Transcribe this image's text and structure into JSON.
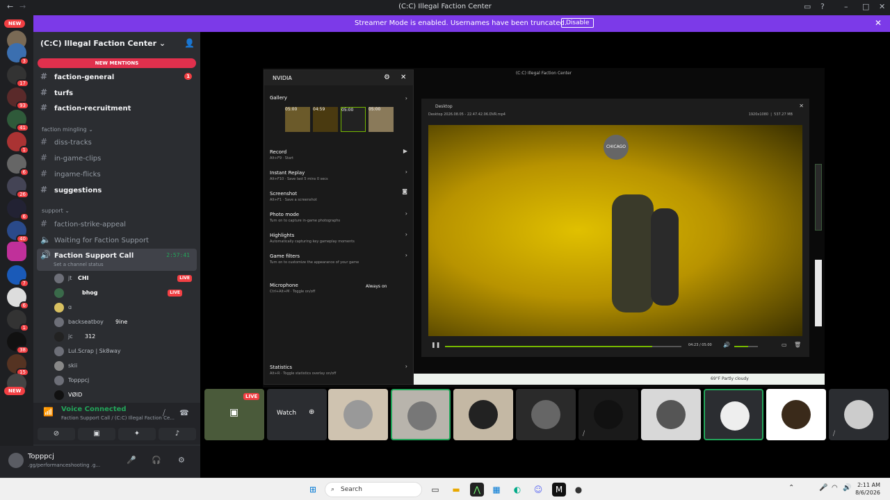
{
  "window": {
    "title": "(C:C) Illegal Faction Center"
  },
  "banner": {
    "text": "Streamer Mode is enabled. Usernames have been truncated.",
    "button": "Disable"
  },
  "server_list": {
    "new_top": "NEW",
    "new_bottom": "NEW",
    "badges": [
      "3",
      "17",
      "93",
      "41",
      "1",
      "6",
      "26",
      "6",
      "40",
      "7",
      "6",
      "1",
      "38",
      "15"
    ]
  },
  "guild": {
    "name": "(C:C) Illegal Faction Center"
  },
  "new_mentions": "NEW MENTIONS",
  "channels": [
    {
      "name": "faction-general",
      "badge": "1"
    },
    {
      "name": "turfs"
    },
    {
      "name": "faction-recruitment"
    }
  ],
  "category_mingling": "faction mingling",
  "mingling_channels": [
    {
      "name": "diss-tracks"
    },
    {
      "name": "in-game-clips"
    },
    {
      "name": "ingame-flicks"
    },
    {
      "name": "suggestions"
    }
  ],
  "category_support": "support",
  "support_channels": [
    {
      "name": "faction-strike-appeal"
    },
    {
      "name": "Waiting for Faction Support"
    }
  ],
  "active_voice": {
    "name": "Faction Support Call",
    "timer": "2:57:41",
    "status": "Set a channel status"
  },
  "members": [
    {
      "name": "jt",
      "tag": "CHI",
      "live": "LIVE"
    },
    {
      "name": "",
      "tag": "bhog",
      "live": "LIVE"
    },
    {
      "name": "ɑ"
    },
    {
      "name": "backseatboy",
      "tag": "9ine"
    },
    {
      "name": "jc",
      "tag": "312"
    },
    {
      "name": "Lul.Scrap | Sk8way"
    },
    {
      "name": "skii"
    },
    {
      "name": "Topppcj"
    },
    {
      "name": "VØID"
    }
  ],
  "voice_panel": {
    "connected": "Voice Connected",
    "sub": "Faction Support Call / (C:C) Illegal Faction Ce..."
  },
  "user": {
    "name": "Topppcj",
    "sub": ".gg/performanceshooting .g..."
  },
  "shared_window": {
    "title": "(C:C) Illegal Faction Center"
  },
  "nvidia": {
    "title": "NVIDIA",
    "gallery": "Gallery",
    "thumbs": [
      "05:00",
      "04:59",
      "05:00",
      "05:00"
    ],
    "items": [
      {
        "label": "Record",
        "sub": "Alt+F9 · Start"
      },
      {
        "label": "Instant Replay",
        "sub": "Alt+F10 · Save last 5 mins 0 secs"
      },
      {
        "label": "Screenshot",
        "sub": "Alt+F1 · Save a screenshot"
      },
      {
        "label": "Photo mode",
        "sub": "Turn on to capture in-game photographs"
      },
      {
        "label": "Highlights",
        "sub": "Automatically capturing key gameplay moments"
      },
      {
        "label": "Game filters",
        "sub": "Turn on to customize the appearance of your game"
      },
      {
        "label": "Microphone",
        "sub": "Ctrl+Alt+M · Toggle on/off",
        "value": "Always on"
      },
      {
        "label": "Statistics",
        "sub": "Alt+R · Toggle statistics overlay on/off"
      }
    ]
  },
  "desktop_player": {
    "title": "Desktop",
    "file": "Desktop 2026.08.05 - 22.47.42.06.DVR.mp4",
    "resolution": "1920x1080",
    "size": "537.27 MB",
    "time": "04:23 / 05:00",
    "progress": 0.877,
    "logo_text": "CHICAGO"
  },
  "weather": {
    "text": "69°F Partly cloudy"
  },
  "tiles": {
    "live": "LIVE",
    "watch": "Watch"
  },
  "taskbar": {
    "search": "Search",
    "time": "2:11 AM",
    "date": "8/6/2026"
  }
}
